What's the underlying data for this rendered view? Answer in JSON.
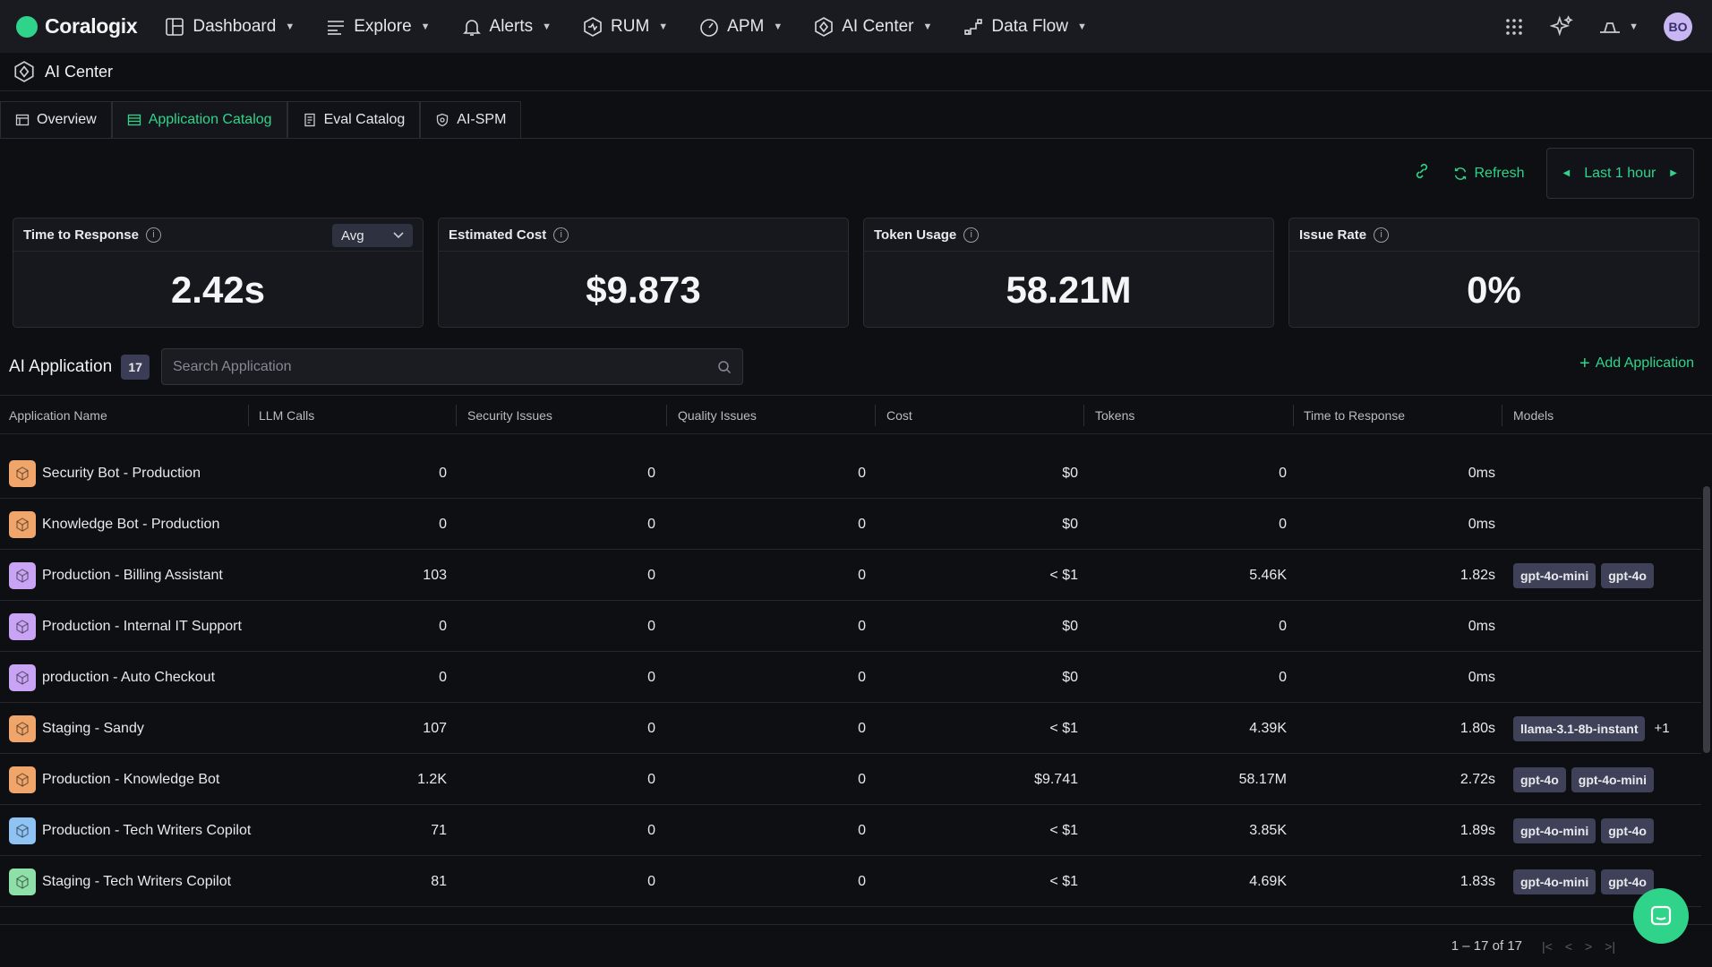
{
  "brand": {
    "name": "Coralogix",
    "accent": "#2fd48a"
  },
  "nav": {
    "items": [
      {
        "label": "Dashboard",
        "icon": "dashboard-icon"
      },
      {
        "label": "Explore",
        "icon": "explore-icon"
      },
      {
        "label": "Alerts",
        "icon": "bell-icon"
      },
      {
        "label": "RUM",
        "icon": "rum-icon"
      },
      {
        "label": "APM",
        "icon": "gauge-icon"
      },
      {
        "label": "AI Center",
        "icon": "ai-center-icon"
      },
      {
        "label": "Data Flow",
        "icon": "data-flow-icon"
      }
    ],
    "avatar_initials": "BO"
  },
  "page": {
    "title": "AI Center"
  },
  "tabs": [
    {
      "label": "Overview",
      "active": false
    },
    {
      "label": "Application Catalog",
      "active": true
    },
    {
      "label": "Eval Catalog",
      "active": false
    },
    {
      "label": "AI-SPM",
      "active": false
    }
  ],
  "toolbar": {
    "refresh_label": "Refresh",
    "time_range": "Last 1 hour"
  },
  "kpis": [
    {
      "title": "Time to Response",
      "value": "2.42s",
      "select": "Avg"
    },
    {
      "title": "Estimated Cost",
      "value": "$9.873"
    },
    {
      "title": "Token Usage",
      "value": "58.21M"
    },
    {
      "title": "Issue Rate",
      "value": "0%"
    }
  ],
  "apps_section": {
    "title": "AI Application",
    "count": "17",
    "search_placeholder": "Search Application",
    "add_label": "Add Application"
  },
  "table": {
    "columns": [
      "Application Name",
      "LLM Calls",
      "Security Issues",
      "Quality Issues",
      "Cost",
      "Tokens",
      "Time to Response",
      "Models"
    ],
    "rows": [
      {
        "name": "Security Bot - Production",
        "icon_color": "#f0a66b",
        "llm_calls": "0",
        "security": "0",
        "quality": "0",
        "cost": "$0",
        "tokens": "0",
        "ttr": "0ms",
        "models": [],
        "extra": ""
      },
      {
        "name": "Knowledge Bot - Production",
        "icon_color": "#f0a66b",
        "llm_calls": "0",
        "security": "0",
        "quality": "0",
        "cost": "$0",
        "tokens": "0",
        "ttr": "0ms",
        "models": [],
        "extra": ""
      },
      {
        "name": "Production - Billing Assistant",
        "icon_color": "#c9a4f4",
        "llm_calls": "103",
        "security": "0",
        "quality": "0",
        "cost": "< $1",
        "tokens": "5.46K",
        "ttr": "1.82s",
        "models": [
          "gpt-4o-mini",
          "gpt-4o"
        ],
        "extra": ""
      },
      {
        "name": "Production - Internal IT Support",
        "icon_color": "#c9a4f4",
        "llm_calls": "0",
        "security": "0",
        "quality": "0",
        "cost": "$0",
        "tokens": "0",
        "ttr": "0ms",
        "models": [],
        "extra": ""
      },
      {
        "name": "production - Auto Checkout",
        "icon_color": "#c9a4f4",
        "llm_calls": "0",
        "security": "0",
        "quality": "0",
        "cost": "$0",
        "tokens": "0",
        "ttr": "0ms",
        "models": [],
        "extra": ""
      },
      {
        "name": "Staging - Sandy",
        "icon_color": "#f0a66b",
        "llm_calls": "107",
        "security": "0",
        "quality": "0",
        "cost": "< $1",
        "tokens": "4.39K",
        "ttr": "1.80s",
        "models": [
          "llama-3.1-8b-instant"
        ],
        "extra": "+1"
      },
      {
        "name": "Production - Knowledge Bot",
        "icon_color": "#f0a66b",
        "llm_calls": "1.2K",
        "security": "0",
        "quality": "0",
        "cost": "$9.741",
        "tokens": "58.17M",
        "ttr": "2.72s",
        "models": [
          "gpt-4o",
          "gpt-4o-mini"
        ],
        "extra": ""
      },
      {
        "name": "Production - Tech Writers Copilot",
        "icon_color": "#8fc3f4",
        "llm_calls": "71",
        "security": "0",
        "quality": "0",
        "cost": "< $1",
        "tokens": "3.85K",
        "ttr": "1.89s",
        "models": [
          "gpt-4o-mini",
          "gpt-4o"
        ],
        "extra": ""
      },
      {
        "name": "Staging - Tech Writers Copilot",
        "icon_color": "#8fe0a8",
        "llm_calls": "81",
        "security": "0",
        "quality": "0",
        "cost": "< $1",
        "tokens": "4.69K",
        "ttr": "1.83s",
        "models": [
          "gpt-4o-mini",
          "gpt-4o"
        ],
        "extra": ""
      }
    ]
  },
  "pagination": {
    "range": "1 – 17 of 17"
  }
}
